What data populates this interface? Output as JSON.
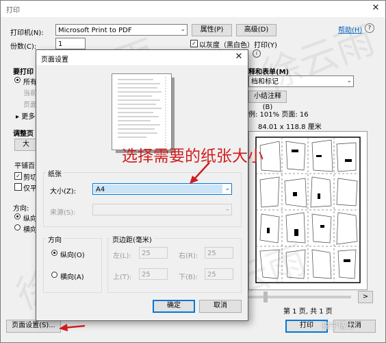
{
  "print_dialog": {
    "title": "打印",
    "help_link": "帮助(H)",
    "printer_label": "打印机(N):",
    "printer_value": "Microsoft Print to PDF",
    "properties_button": "属性(P)",
    "advanced_button": "高级(D)",
    "copies_label": "份数(C):",
    "copies_value": "1",
    "grayscale_label": "以灰度（黑白色）打印(Y)",
    "grayscale_checked": true,
    "pages_heading": "要打印",
    "all_option": "所有",
    "current_option": "当前",
    "pages_option": "页面",
    "more_option": "更多",
    "sizing_heading": "调整页",
    "size_button_fragment": "大",
    "tile_label": "平铺百分",
    "cut_label": "剪切",
    "only_label": "仅平",
    "orientation_label": "方向:",
    "portrait_option": "纵向",
    "landscape_option": "横向",
    "comments_heading": "释和表单(M)",
    "comments_value": "档和标记",
    "summarize_button": "小结注释(B)",
    "scale_info": "例: 101% 页面: 16",
    "paper_size_info": "84.01 x 118.8 厘米",
    "page_count": "第 1 页, 共 1 页",
    "page_setup_button": "页面设置(S)...",
    "print_button": "打印",
    "cancel_button": "取消"
  },
  "page_setup": {
    "title": "页面设置",
    "paper_group": "纸张",
    "size_label": "大小(Z):",
    "size_value": "A4",
    "source_label": "来源(S):",
    "source_value": "",
    "orientation_group": "方向",
    "portrait": "纵向(O)",
    "landscape": "横向(A)",
    "margins_group": "页边距(毫米)",
    "left_label": "左(L):",
    "left_value": "25",
    "right_label": "右(R):",
    "right_value": "25",
    "top_label": "上(T):",
    "top_value": "25",
    "bottom_label": "下(B):",
    "bottom_value": "25",
    "ok_button": "确定",
    "cancel_button": "取消"
  },
  "annotation": "选择需要的纸张大小",
  "watermark_text": "徐云雨",
  "corner_watermark": "猫宁博士",
  "colors": {
    "accent": "#0078d7",
    "annotation": "#d01c1c",
    "link": "#0066cc"
  }
}
